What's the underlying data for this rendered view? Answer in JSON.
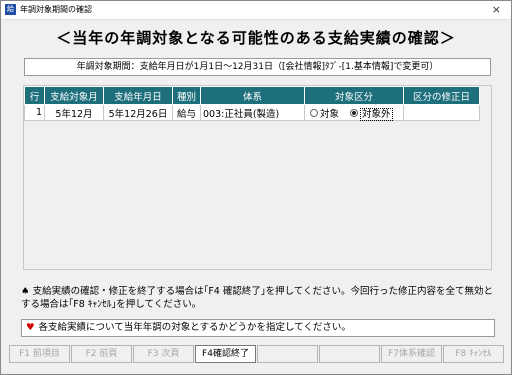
{
  "window": {
    "title": "年調対象期間の確認",
    "close_glyph": "×",
    "app_icon_text": "給"
  },
  "heading": "＜当年の年調対象となる可能性のある支給実績の確認＞",
  "period_text": "年調対象期間：支給年月日が1月1日～12月31日（[会社情報]ﾀﾌﾞ-[1.基本情報]で変更可）",
  "table": {
    "headers": [
      "行",
      "支給対象月",
      "支給年月日",
      "種別",
      "体系",
      "対象区分",
      "区分の修正日"
    ],
    "rows": [
      {
        "row": "1",
        "month": "5年12月",
        "date": "5年12月26日",
        "kind": "給与",
        "system": "003:正社員(製造)",
        "opt1": "対象",
        "opt2": "対象外",
        "selected": "対象外",
        "mod_date": ""
      }
    ]
  },
  "note": {
    "mark": "♠",
    "text": "支給実績の確認・修正を終了する場合は｢F4 確認終了｣を押してください。今回行った修正内容を全て無効とする場合は｢F8 ｷｬﾝｾﾙ｣を押してください。"
  },
  "message": {
    "icon": "♥",
    "text": "各支給実績について当年年調の対象とするかどうかを指定してください。"
  },
  "fkeys": [
    {
      "label": "F1 前項目",
      "enabled": false
    },
    {
      "label": "F2 前頁",
      "enabled": false
    },
    {
      "label": "F3 次頁",
      "enabled": false
    },
    {
      "label": "F4確認終了",
      "enabled": true
    },
    {
      "label": "",
      "enabled": false
    },
    {
      "label": "",
      "enabled": false
    },
    {
      "label": "F7体系確認",
      "enabled": false
    },
    {
      "label": "F8 ｷｬﾝｾﾙ",
      "enabled": false
    }
  ]
}
